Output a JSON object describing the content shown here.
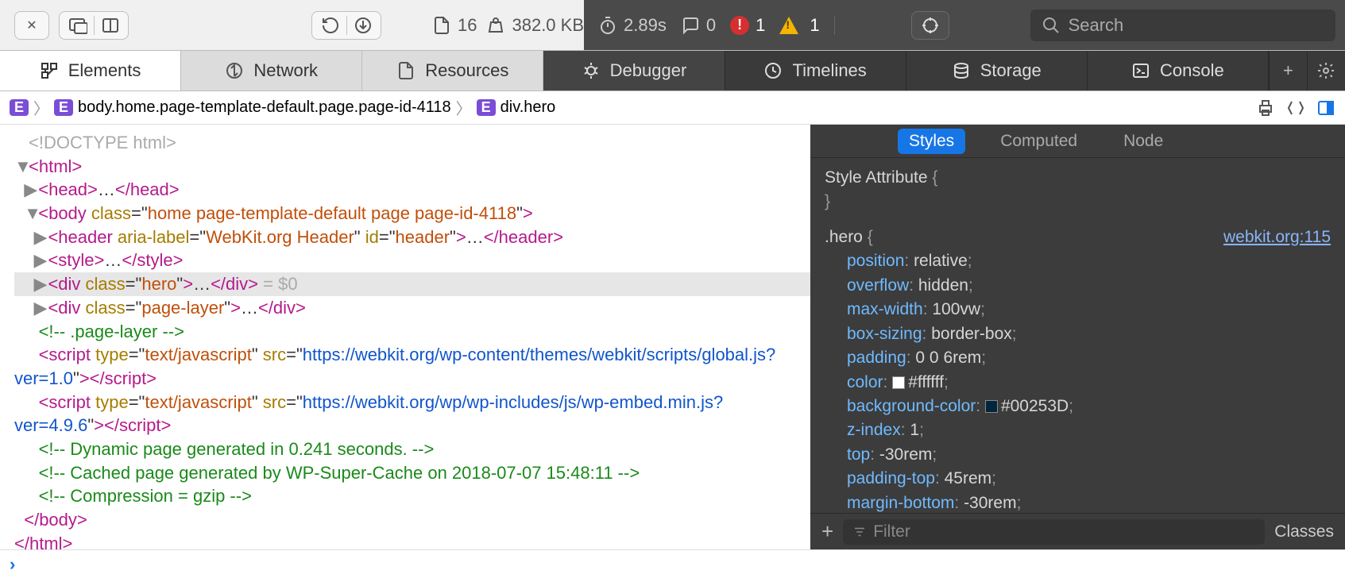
{
  "toolbar": {
    "files": "16",
    "size": "382.0 KB",
    "time": "2.89s",
    "messages": "0",
    "errors": "1",
    "warnings": "1",
    "search_placeholder": "Search"
  },
  "tabs": [
    "Elements",
    "Network",
    "Resources",
    "Debugger",
    "Timelines",
    "Storage",
    "Console"
  ],
  "breadcrumb": {
    "body": "body.home.page-template-default.page.page-id-4118",
    "selected": "div.hero"
  },
  "dom": {
    "doctype": "<!DOCTYPE html>",
    "body_class": "home page-template-default page page-id-4118",
    "header_aria": "WebKit.org Header",
    "header_id": "header",
    "hero_class": "hero",
    "hero_suffix": "= $0",
    "pagelayer_class": "page-layer",
    "comment_pagelayer": "<!-- .page-layer -->",
    "script1_type": "text/javascript",
    "script1_src": "https://webkit.org/wp-content/themes/webkit/scripts/global.js?ver=1.0",
    "script2_type": "text/javascript",
    "script2_src": "https://webkit.org/wp/wp-includes/js/wp-embed.min.js?ver=4.9.6",
    "comment_dyn": "<!-- Dynamic page generated in 0.241 seconds. -->",
    "comment_cache": "<!-- Cached page generated by WP-Super-Cache on 2018-07-07 15:48:11 -->",
    "comment_gzip": "<!-- Compression = gzip -->"
  },
  "styles": {
    "tabs": [
      "Styles",
      "Computed",
      "Node"
    ],
    "style_attr_label": "Style Attribute",
    "rule_selector": ".hero",
    "rule_source": "webkit.org:115",
    "props": [
      {
        "n": "position",
        "v": "relative"
      },
      {
        "n": "overflow",
        "v": "hidden"
      },
      {
        "n": "max-width",
        "v": "100vw"
      },
      {
        "n": "box-sizing",
        "v": "border-box"
      },
      {
        "n": "padding",
        "v": "0 0 6rem"
      },
      {
        "n": "color",
        "v": "#ffffff",
        "swatch": "#ffffff"
      },
      {
        "n": "background-color",
        "v": "#00253D",
        "swatch": "#00253D"
      },
      {
        "n": "z-index",
        "v": "1"
      },
      {
        "n": "top",
        "v": "-30rem"
      },
      {
        "n": "padding-top",
        "v": "45rem"
      },
      {
        "n": "margin-bottom",
        "v": "-30rem"
      }
    ],
    "filter_placeholder": "Filter",
    "classes_label": "Classes"
  }
}
